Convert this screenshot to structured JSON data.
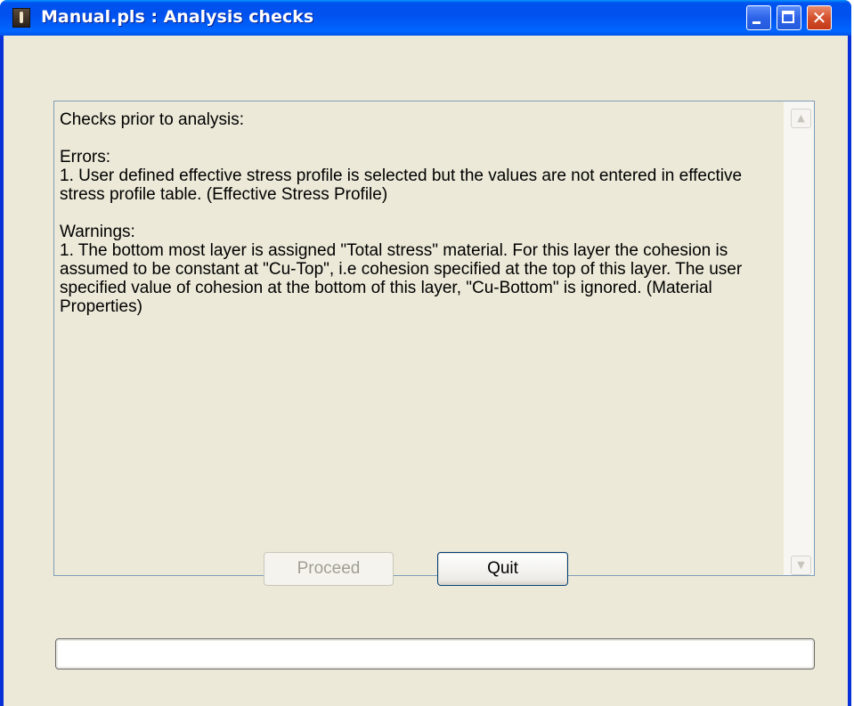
{
  "window": {
    "title": "Manual.pls : Analysis checks",
    "controls": {
      "minimize": "minimize",
      "maximize": "maximize",
      "close_glyph": "✕"
    },
    "icon": "app-icon"
  },
  "messages": {
    "text": "Checks prior to analysis:\n\nErrors:\n1. User defined effective stress profile is selected but the values are not entered in effective stress profile table. (Effective Stress Profile)\n\nWarnings:\n1. The bottom most layer is assigned \"Total stress\" material. For this layer the cohesion is assumed to be constant at \"Cu-Top\", i.e cohesion specified at the top of this layer. The user specified value of cohesion at the bottom of this layer, \"Cu-Bottom\" is ignored. (Material Properties)",
    "scroll_up_glyph": "▲",
    "scroll_down_glyph": "▼"
  },
  "buttons": {
    "proceed_label": "Proceed",
    "proceed_enabled": false,
    "quit_label": "Quit"
  },
  "progress": {
    "value": 0
  },
  "colors": {
    "titlebar": "#0053ee",
    "dialog_bg": "#ece9d8",
    "close_button": "#d5502d",
    "border_accent": "#7f9db9"
  }
}
